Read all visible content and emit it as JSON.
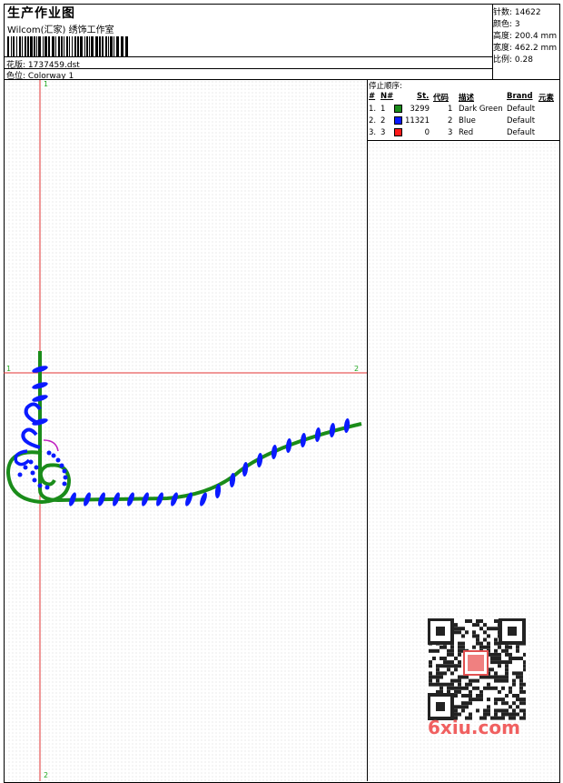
{
  "header": {
    "title": "生产作业图",
    "company": "Wilcom(汇家) 绣饰工作室",
    "design_label": "花版:",
    "design_value": "1737459.dst",
    "colorway_label": "色位:",
    "colorway_value": "Colorway 1"
  },
  "specs": [
    {
      "label": "针数:",
      "value": "14622"
    },
    {
      "label": "颜色:",
      "value": "3"
    },
    {
      "label": "高度:",
      "value": "200.4 mm"
    },
    {
      "label": "宽度:",
      "value": "462.2 mm"
    },
    {
      "label": "比例:",
      "value": "0.28"
    }
  ],
  "stop_sequence": {
    "title": "停止顺序:",
    "headers": [
      "#",
      "N#",
      "St.",
      "代码",
      "描述",
      "Brand",
      "元素"
    ],
    "rows": [
      {
        "idx": "1.",
        "n": "1",
        "color": "#1a8c1a",
        "st": "3299",
        "code": "1",
        "desc": "Dark Green",
        "brand": "Default"
      },
      {
        "idx": "2.",
        "n": "2",
        "color": "#0a1aff",
        "st": "11321",
        "code": "2",
        "desc": "Blue",
        "brand": "Default"
      },
      {
        "idx": "3.",
        "n": "3",
        "color": "#ff1a1a",
        "st": "0",
        "code": "3",
        "desc": "Red",
        "brand": "Default"
      }
    ]
  },
  "axes": {
    "top_label": "1",
    "bottom_label": "2",
    "left_label": "1",
    "right_label": "2"
  },
  "watermark": {
    "text": "6xiu.com"
  }
}
